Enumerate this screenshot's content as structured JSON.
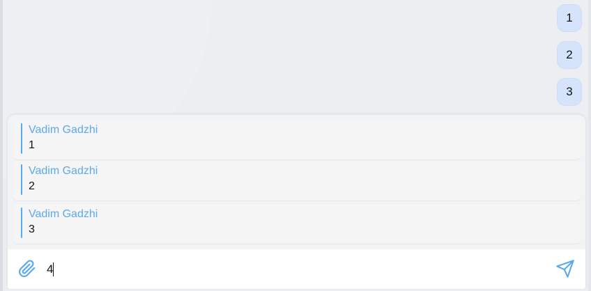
{
  "messages": [
    {
      "text": "1"
    },
    {
      "text": "2"
    },
    {
      "text": "3"
    }
  ],
  "replies": [
    {
      "author": "Vadim Gadzhi",
      "text": "1"
    },
    {
      "author": "Vadim Gadzhi",
      "text": "2"
    },
    {
      "author": "Vadim Gadzhi",
      "text": "3"
    }
  ],
  "composer": {
    "value": "4",
    "attach_icon": "paperclip-icon",
    "send_icon": "send-icon"
  },
  "colors": {
    "accent": "#5aa9ec",
    "bubble": "#d6e4fb",
    "background": "#eceef1"
  }
}
